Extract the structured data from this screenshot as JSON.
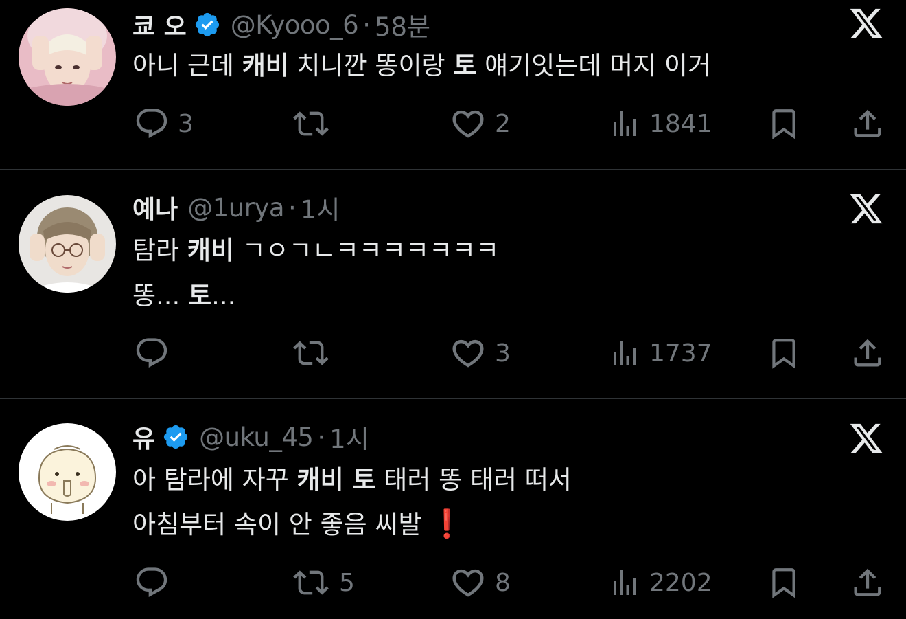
{
  "tweets": [
    {
      "name": "쿄 오",
      "verified": true,
      "handle": "@Kyooo_6",
      "separator": "·",
      "time": "58분",
      "lines": [
        [
          {
            "text": "아니 근데 ",
            "bold": false
          },
          {
            "text": "캐비",
            "bold": true
          },
          {
            "text": " 치니깐 똥이랑 ",
            "bold": false
          },
          {
            "text": "토",
            "bold": true
          },
          {
            "text": " 얘기잇는데 머지 이거",
            "bold": false
          }
        ]
      ],
      "replies": "3",
      "retweets": "",
      "likes": "2",
      "views": "1841"
    },
    {
      "name": "예나",
      "verified": false,
      "handle": "@1urya",
      "separator": "·",
      "time": "1시",
      "lines": [
        [
          {
            "text": "탐라 ",
            "bold": false
          },
          {
            "text": "캐비",
            "bold": true
          },
          {
            "text": " ㄱㅇㄱㄴㅋㅋㅋㅋㅋㅋㅋ",
            "bold": false
          }
        ],
        [
          {
            "text": "똥... ",
            "bold": false
          },
          {
            "text": "토",
            "bold": true
          },
          {
            "text": "...",
            "bold": false
          }
        ]
      ],
      "replies": "",
      "retweets": "",
      "likes": "3",
      "views": "1737"
    },
    {
      "name": "유",
      "verified": true,
      "handle": "@uku_45",
      "separator": "·",
      "time": "1시",
      "lines": [
        [
          {
            "text": "아 탐라에 자꾸 ",
            "bold": false
          },
          {
            "text": "캐비 토",
            "bold": true
          },
          {
            "text": " 태러 똥 태러 떠서",
            "bold": false
          }
        ],
        [
          {
            "text": "아침부터 속이 안 좋음 씨발 ",
            "bold": false
          },
          {
            "text": "❗",
            "bold": false,
            "emoji": true
          }
        ]
      ],
      "replies": "",
      "retweets": "5",
      "likes": "8",
      "views": "2202"
    }
  ],
  "icons": {
    "reply": "reply-icon",
    "retweet": "retweet-icon",
    "like": "heart-icon",
    "views": "views-icon",
    "bookmark": "bookmark-icon",
    "share": "share-icon",
    "brand": "x-logo-icon",
    "verified": "verified-badge-icon"
  },
  "colors": {
    "background": "#000000",
    "text": "#e7e9ea",
    "secondary": "#71767b",
    "divider": "#2f3336",
    "verified": "#1d9bf0",
    "exclamation": "#e0242c"
  }
}
